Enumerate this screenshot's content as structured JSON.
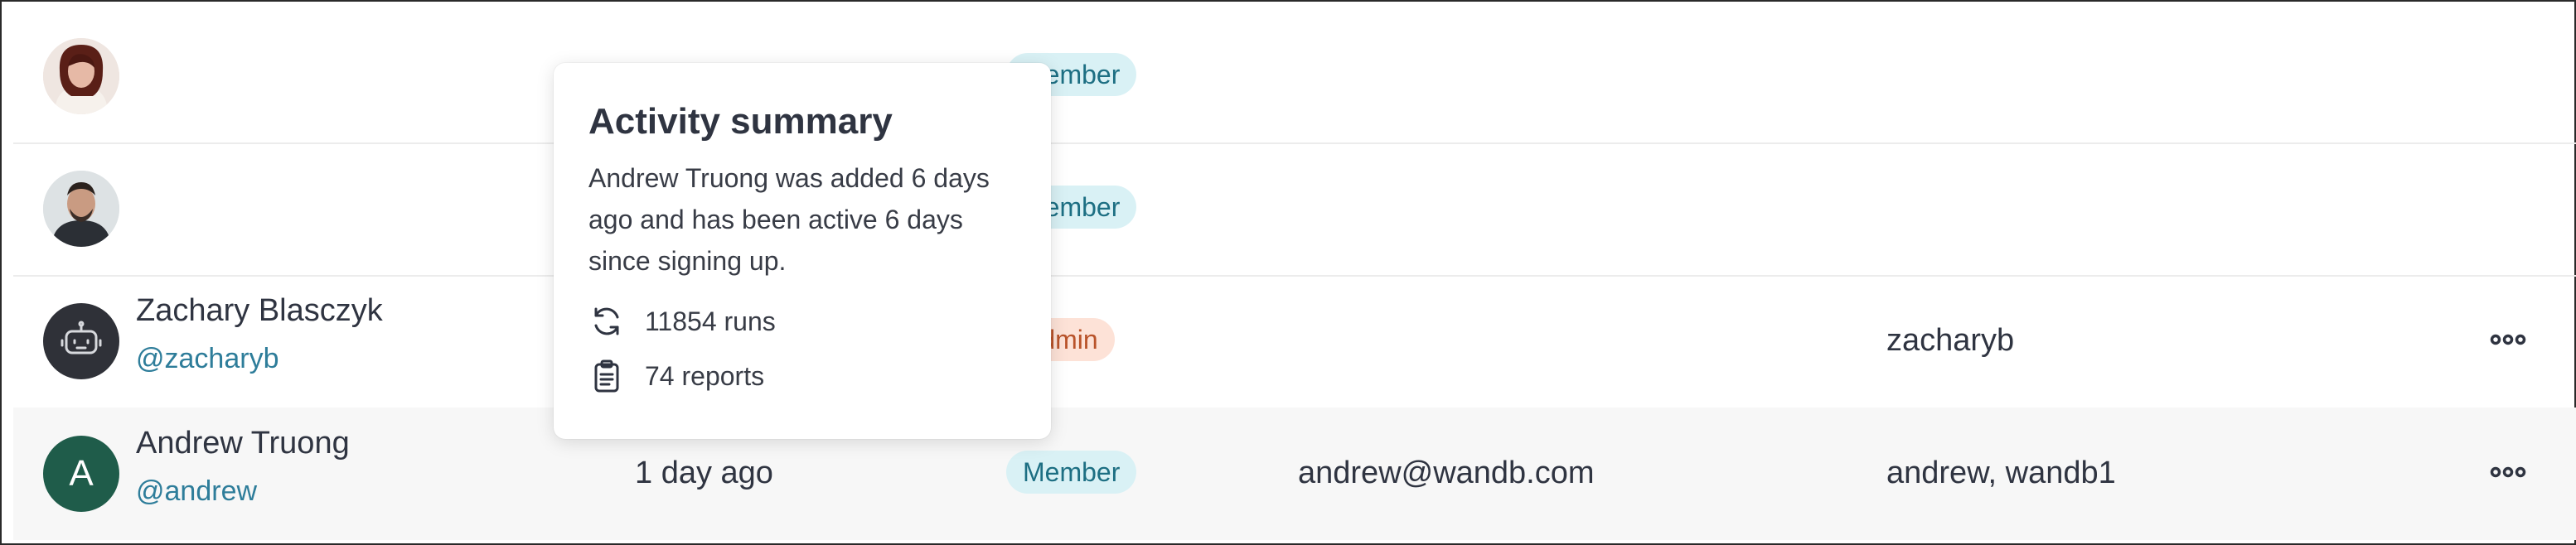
{
  "rows": [
    {
      "name": "",
      "handle": "",
      "role": "Member",
      "avatar_icon": "person-photo-avatar-icon"
    },
    {
      "name": "",
      "handle": "",
      "role": "Member",
      "avatar_icon": "person-photo-avatar-icon"
    },
    {
      "name": "Zachary Blasczyk",
      "handle": "@zacharyb",
      "role": "Admin",
      "teams": "zacharyb",
      "avatar_icon": "robot-avatar-icon"
    },
    {
      "name": "Andrew Truong",
      "handle": "@andrew",
      "last_active": "1 day ago",
      "role": "Member",
      "email": "andrew@wandb.com",
      "teams": "andrew, wandb1",
      "avatar_letter": "A"
    }
  ],
  "tooltip": {
    "title": "Activity summary",
    "body": "Andrew Truong was added 6 days ago and has been active 6 days since signing up.",
    "runs": "11854 runs",
    "reports": "74 reports",
    "runs_icon": "refresh-icon",
    "reports_icon": "clipboard-icon"
  },
  "colors": {
    "member_bg": "#d9f1f5",
    "member_text": "#1d6f83",
    "admin_bg": "#fde2d7",
    "admin_text": "#b9532a",
    "handle": "#2e7d9a",
    "andrew_avatar": "#1f5c4a"
  }
}
